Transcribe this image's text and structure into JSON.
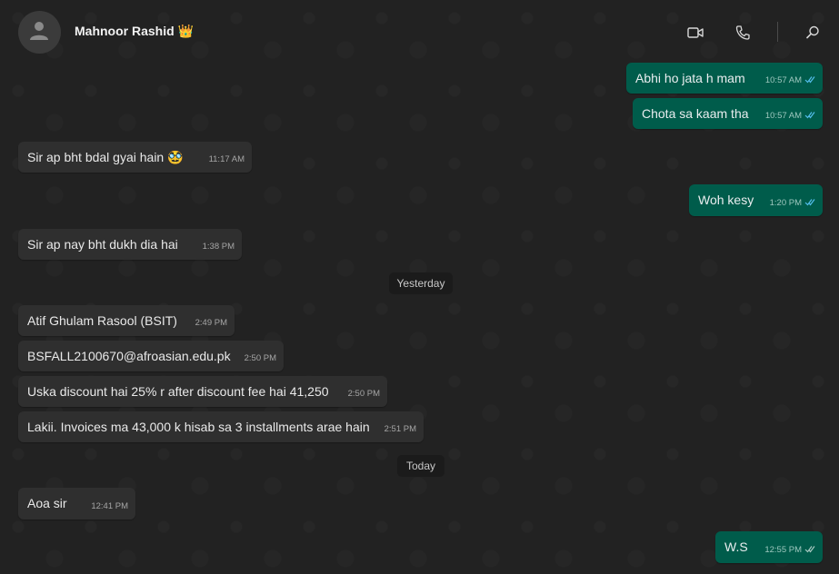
{
  "contact": {
    "name": "Mahnoor Rashid",
    "badge": "👑"
  },
  "header_icons": [
    "video-call-icon",
    "voice-call-icon",
    "search-icon"
  ],
  "messages": [
    {
      "dir": "out",
      "text": "Abhi ho jata h mam",
      "time": "10:57 AM"
    },
    {
      "dir": "out",
      "text": "Chota sa kaam tha",
      "time": "10:57 AM"
    },
    {
      "dir": "in",
      "text": "Sir ap bht bdal gyai hain 🥸",
      "time": "11:17 AM"
    },
    {
      "dir": "out",
      "text": "Woh kesy",
      "time": "1:20 PM"
    },
    {
      "dir": "in",
      "text": "Sir ap nay bht dukh dia hai",
      "time": "1:38 PM"
    },
    {
      "dir": "in",
      "text": "Atif Ghulam Rasool (BSIT)",
      "time": "2:49 PM"
    },
    {
      "dir": "in",
      "text": "BSFALL2100670@afroasian.edu.pk",
      "time": "2:50 PM"
    },
    {
      "dir": "in",
      "text": "Uska discount hai 25% r after discount fee hai 41,250",
      "time": "2:50 PM"
    },
    {
      "dir": "in",
      "text": "Lakii. Invoices ma 43,000 k hisab sa 3 installments arae hain",
      "time": "2:51 PM"
    },
    {
      "dir": "in",
      "text": "Aoa sir",
      "time": "12:41 PM"
    },
    {
      "dir": "out",
      "text": "W.S",
      "time": "12:55 PM"
    }
  ],
  "date_chips": {
    "yesterday": "Yesterday",
    "today": "Today"
  },
  "colors": {
    "background": "#222222",
    "incoming_bubble": "#2f2f2f",
    "outgoing_bubble": "#005c4b",
    "read_tick": "#53bdeb"
  }
}
